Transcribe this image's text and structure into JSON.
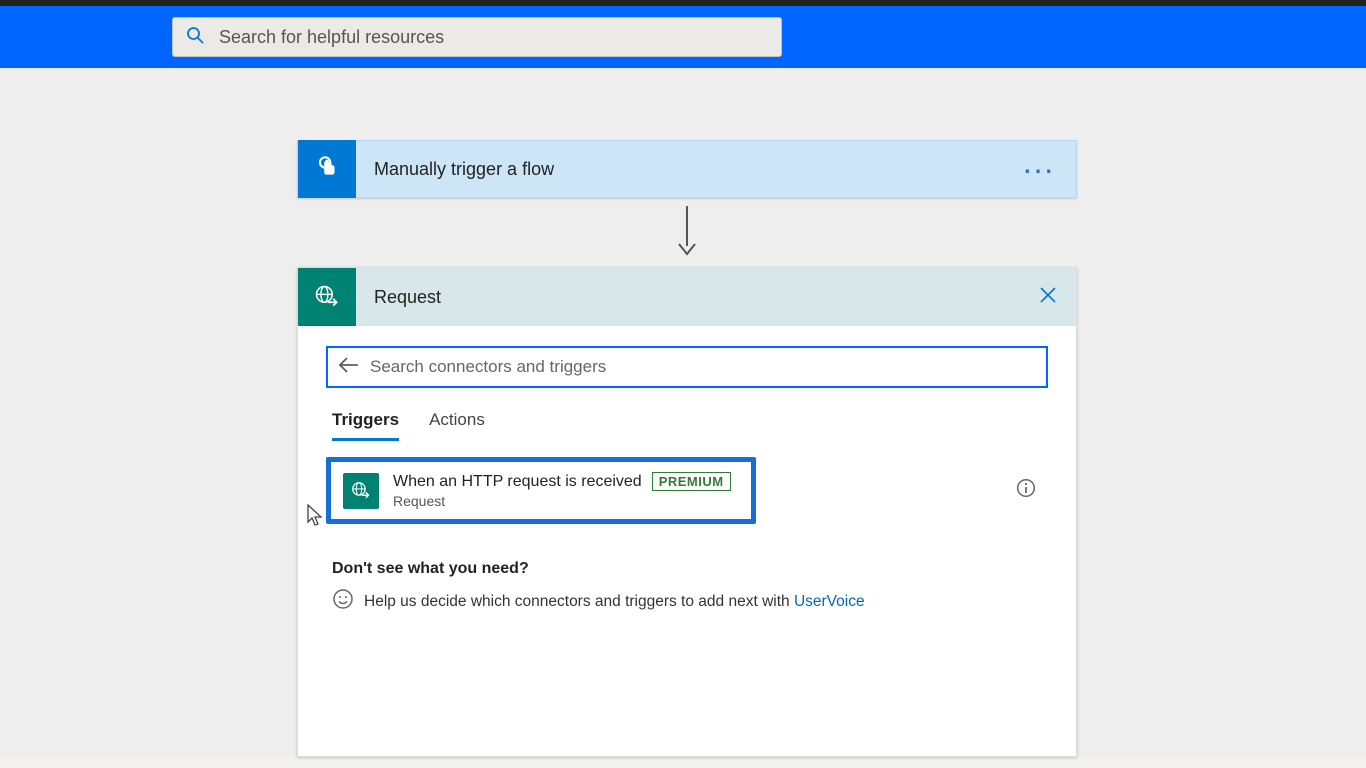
{
  "header": {
    "search_placeholder": "Search for helpful resources"
  },
  "trigger_card": {
    "title": "Manually trigger a flow"
  },
  "panel": {
    "title": "Request",
    "search_placeholder": "Search connectors and triggers",
    "tabs": {
      "triggers": "Triggers",
      "actions": "Actions"
    },
    "result": {
      "title": "When an HTTP request is received",
      "badge": "PREMIUM",
      "subtitle": "Request"
    },
    "help": {
      "title": "Don't see what you need?",
      "text": "Help us decide which connectors and triggers to add next with ",
      "link": "UserVoice"
    }
  }
}
